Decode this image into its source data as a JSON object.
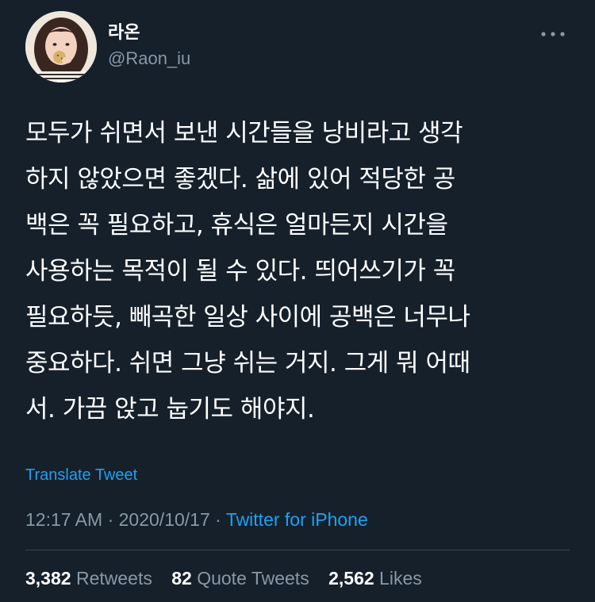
{
  "author": {
    "display_name": "라온",
    "handle": "@Raon_iu",
    "avatar_icon": "profile-photo"
  },
  "menu": {
    "icon": "more-horizontal-icon"
  },
  "tweet": {
    "text": "모두가 쉬면서 보낸 시간들을 낭비라고 생각\n하지 않았으면 좋겠다. 삶에 있어 적당한 공\n백은 꼭 필요하고, 휴식은 얼마든지 시간을\n사용하는 목적이 될 수 있다. 띄어쓰기가 꼭\n필요하듯, 빼곡한 일상 사이에 공백은 너무나\n중요하다. 쉬면 그냥 쉬는 거지. 그게 뭐 어때\n서. 가끔 앉고 눕기도 해야지.",
    "translate_label": "Translate Tweet"
  },
  "meta": {
    "time": "12:17 AM",
    "separator1": " · ",
    "date": "2020/10/17",
    "separator2": " · ",
    "source": "Twitter for iPhone"
  },
  "stats": {
    "retweets": {
      "count": "3,382",
      "label": "Retweets"
    },
    "quotes": {
      "count": "82",
      "label": "Quote Tweets"
    },
    "likes": {
      "count": "2,562",
      "label": "Likes"
    }
  },
  "colors": {
    "background": "#15202b",
    "text": "#ffffff",
    "secondary": "#8899a6",
    "accent": "#1da1f2",
    "divider": "#38444d"
  }
}
